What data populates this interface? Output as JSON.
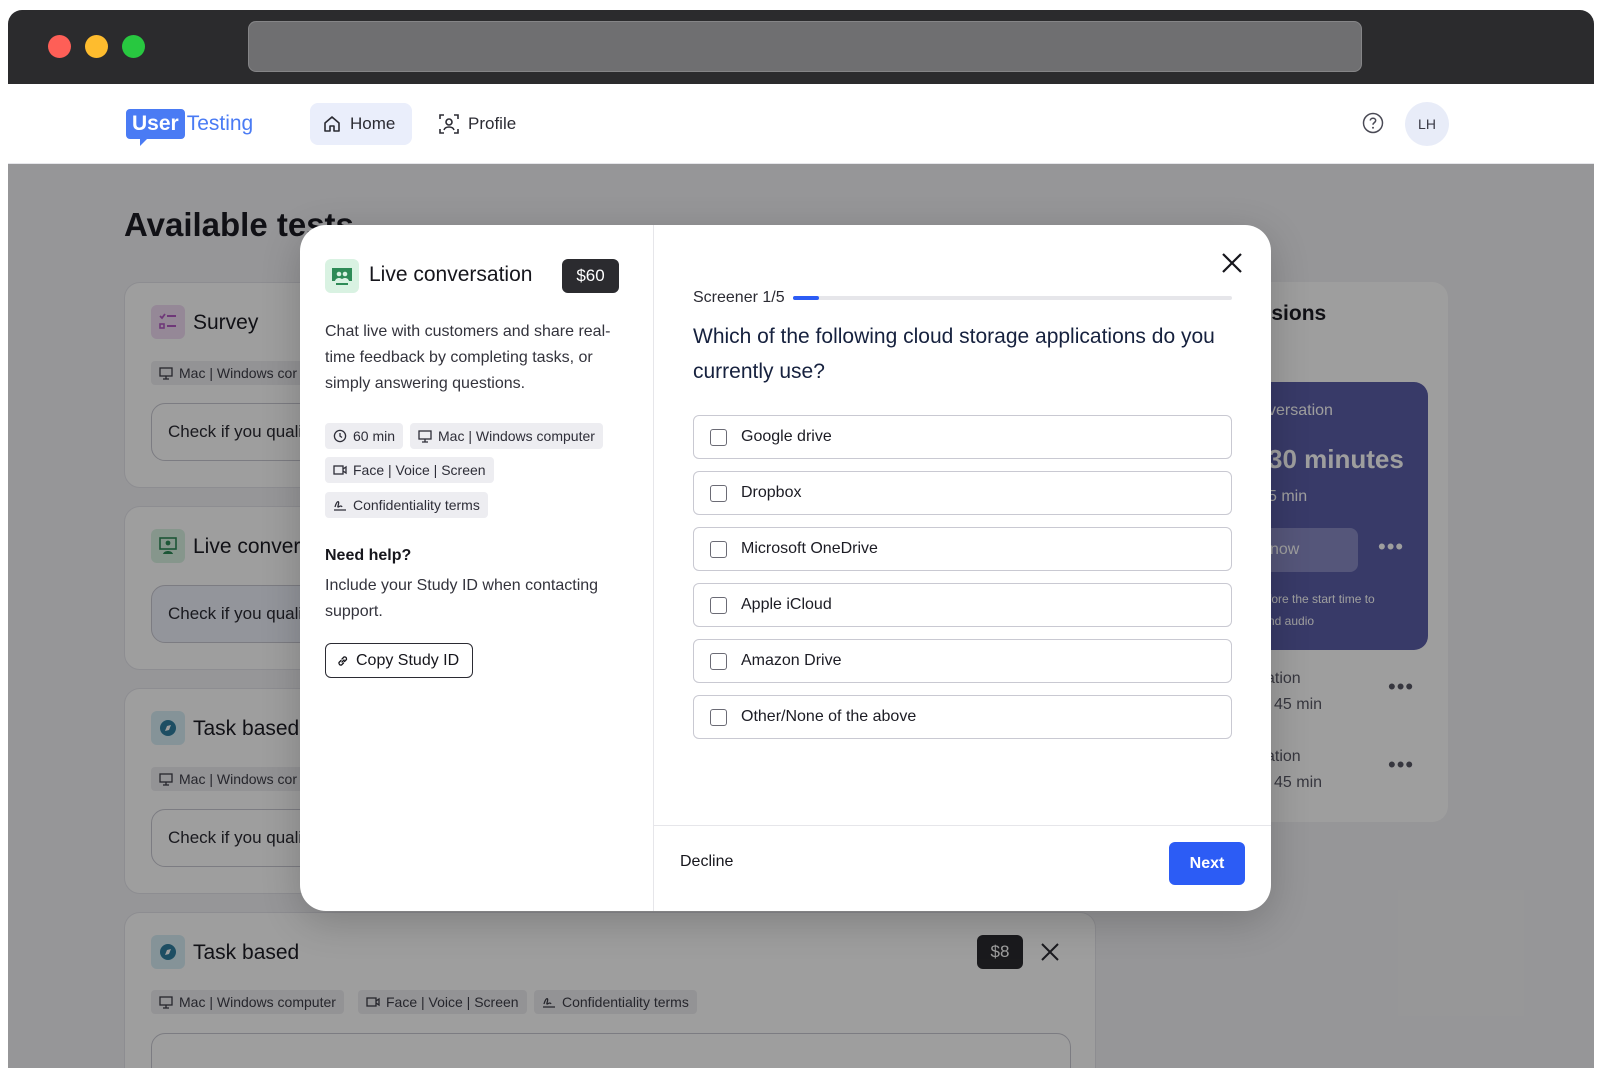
{
  "app": {
    "logo_user": "User",
    "logo_testing": "Testing",
    "nav": {
      "home": "Home",
      "profile": "Profile"
    },
    "avatar_initials": "LH"
  },
  "background": {
    "page_title": "Available tests",
    "cards": [
      {
        "title": "Survey",
        "chip": "Mac | Windows cor",
        "button": "Check if you quali"
      },
      {
        "title": "Live conver",
        "button": "Check if you quali"
      },
      {
        "title": "Task based",
        "chip": "Mac | Windows cor",
        "button": "Check if you quali"
      },
      {
        "title": "Task based",
        "price": "$8",
        "chips": [
          "Mac | Windows computer",
          "Face | Voice | Screen",
          "Confidentiality terms"
        ]
      }
    ],
    "side": {
      "heading": "essions",
      "purple_title": "versation",
      "purple_time": "30 minutes",
      "purple_duration": "5 min",
      "purple_button": "now",
      "purple_note_1": "fore the start time to",
      "purple_note_2": "nd audio",
      "rows": [
        {
          "title": "sation",
          "duration": "45 min"
        },
        {
          "title": "sation",
          "duration": "45 min"
        }
      ]
    }
  },
  "modal": {
    "title": "Live conversation",
    "price": "$60",
    "description": "Chat live with customers and share real-time feedback by completing tasks, or simply answering questions.",
    "chips": {
      "duration": "60 min",
      "device": "Mac | Windows computer",
      "recording": "Face | Voice | Screen",
      "terms": "Confidentiality terms"
    },
    "need_help_title": "Need help?",
    "need_help_text": "Include your Study ID when contacting support.",
    "copy_button": "Copy Study ID",
    "screener_label": "Screener 1/5",
    "progress": 0.06,
    "question": "Which of the following cloud storage applications do you currently use?",
    "options": [
      "Google drive",
      "Dropbox",
      "Microsoft OneDrive",
      "Apple iCloud",
      "Amazon Drive",
      "Other/None of the above"
    ],
    "decline": "Decline",
    "next": "Next"
  },
  "colors": {
    "accent": "#2c5cf5",
    "logo": "#4a7bf4",
    "purple_card": "#5b5ea8"
  }
}
